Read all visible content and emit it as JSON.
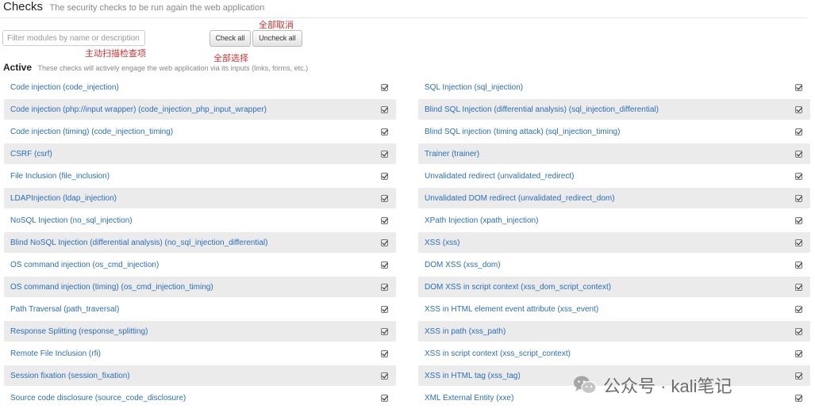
{
  "header": {
    "title": "Checks",
    "subtitle": "The security checks to be run again the web application"
  },
  "filter": {
    "placeholder": "Filter modules by name or description",
    "value": ""
  },
  "buttons": {
    "check_all": "Check all",
    "uncheck_all": "Uncheck all"
  },
  "annotations": {
    "uncheck_all_note": "全部取消",
    "active_scan_note": "主动扫描检查项",
    "check_all_note": "全部选择"
  },
  "active": {
    "title": "Active",
    "subtitle": "These checks will actively engage the web application via its inputs (links, forms, etc.)"
  },
  "checks_left": [
    {
      "label": "Code injection (code_injection)",
      "checked": true
    },
    {
      "label": "Code injection (php://input wrapper) (code_injection_php_input_wrapper)",
      "checked": true
    },
    {
      "label": "Code injection (timing) (code_injection_timing)",
      "checked": true
    },
    {
      "label": "CSRF (csrf)",
      "checked": true
    },
    {
      "label": "File Inclusion (file_inclusion)",
      "checked": true
    },
    {
      "label": "LDAPInjection (ldap_injection)",
      "checked": true
    },
    {
      "label": "NoSQL Injection (no_sql_injection)",
      "checked": true
    },
    {
      "label": "Blind NoSQL Injection (differential analysis) (no_sql_injection_differential)",
      "checked": true
    },
    {
      "label": "OS command injection (os_cmd_injection)",
      "checked": true
    },
    {
      "label": "OS command injection (timing) (os_cmd_injection_timing)",
      "checked": true
    },
    {
      "label": "Path Traversal (path_traversal)",
      "checked": true
    },
    {
      "label": "Response Splitting (response_splitting)",
      "checked": true
    },
    {
      "label": "Remote File Inclusion (rfi)",
      "checked": true
    },
    {
      "label": "Session fixation (session_fixation)",
      "checked": true
    },
    {
      "label": "Source code disclosure (source_code_disclosure)",
      "checked": true
    }
  ],
  "checks_right": [
    {
      "label": "SQL Injection (sql_injection)",
      "checked": true
    },
    {
      "label": "Blind SQL Injection (differential analysis) (sql_injection_differential)",
      "checked": true
    },
    {
      "label": "Blind SQL injection (timing attack) (sql_injection_timing)",
      "checked": true
    },
    {
      "label": "Trainer (trainer)",
      "checked": true
    },
    {
      "label": "Unvalidated redirect (unvalidated_redirect)",
      "checked": true
    },
    {
      "label": "Unvalidated DOM redirect (unvalidated_redirect_dom)",
      "checked": true
    },
    {
      "label": "XPath Injection (xpath_injection)",
      "checked": true
    },
    {
      "label": "XSS (xss)",
      "checked": true
    },
    {
      "label": "DOM XSS (xss_dom)",
      "checked": true
    },
    {
      "label": "DOM XSS in script context (xss_dom_script_context)",
      "checked": true
    },
    {
      "label": "XSS in HTML element event attribute (xss_event)",
      "checked": true
    },
    {
      "label": "XSS in path (xss_path)",
      "checked": true
    },
    {
      "label": "XSS in script context (xss_script_context)",
      "checked": true
    },
    {
      "label": "XSS in HTML tag (xss_tag)",
      "checked": true
    },
    {
      "label": "XML External Entity (xxe)",
      "checked": true
    }
  ],
  "watermark": {
    "icon": "wechat-icon",
    "text": "公众号 · kali笔记"
  }
}
